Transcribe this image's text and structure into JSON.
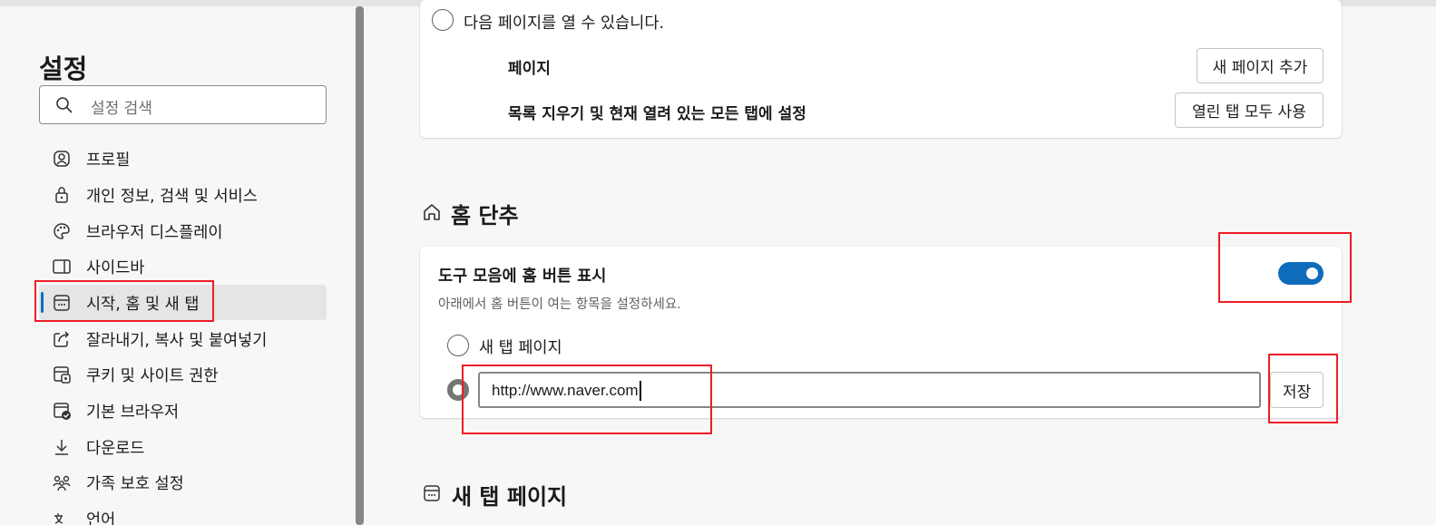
{
  "sidebar": {
    "title": "설정",
    "search_placeholder": "설정 검색",
    "items": [
      {
        "label": "프로필",
        "icon": "profile-icon"
      },
      {
        "label": "개인 정보, 검색 및 서비스",
        "icon": "lock-icon"
      },
      {
        "label": "브라우저 디스플레이",
        "icon": "palette-icon"
      },
      {
        "label": "사이드바",
        "icon": "sidebar-icon"
      },
      {
        "label": "시작, 홈 및 새 탭",
        "icon": "start-home-icon",
        "active": true
      },
      {
        "label": "잘라내기, 복사 및 붙여넣기",
        "icon": "share-icon"
      },
      {
        "label": "쿠키 및 사이트 권한",
        "icon": "cookie-icon"
      },
      {
        "label": "기본 브라우저",
        "icon": "default-browser-icon"
      },
      {
        "label": "다운로드",
        "icon": "download-icon"
      },
      {
        "label": "가족 보호 설정",
        "icon": "family-icon"
      },
      {
        "label": "언어",
        "icon": "language-icon"
      }
    ]
  },
  "startup_card": {
    "radio_label": "다음 페이지를 열 수 있습니다.",
    "pages_label": "페이지",
    "add_page_button": "새 페이지 추가",
    "clear_label": "목록 지우기 및 현재 열려 있는 모든 탭에 설정",
    "use_open_tabs_button": "열린 탭 모두 사용"
  },
  "home_section": {
    "title": "홈 단추",
    "toggle_label": "도구 모음에 홈 버튼 표시",
    "toggle_desc": "아래에서 홈 버튼이 여는 항목을 설정하세요.",
    "toggle_on": true,
    "option_new_tab": "새 탭 페이지",
    "url_value": "http://www.naver.com",
    "save_button": "저장"
  },
  "newtab_section": {
    "title": "새 탭 페이지"
  },
  "colors": {
    "accent": "#0f6cbd",
    "highlight": "#ee1d25"
  }
}
